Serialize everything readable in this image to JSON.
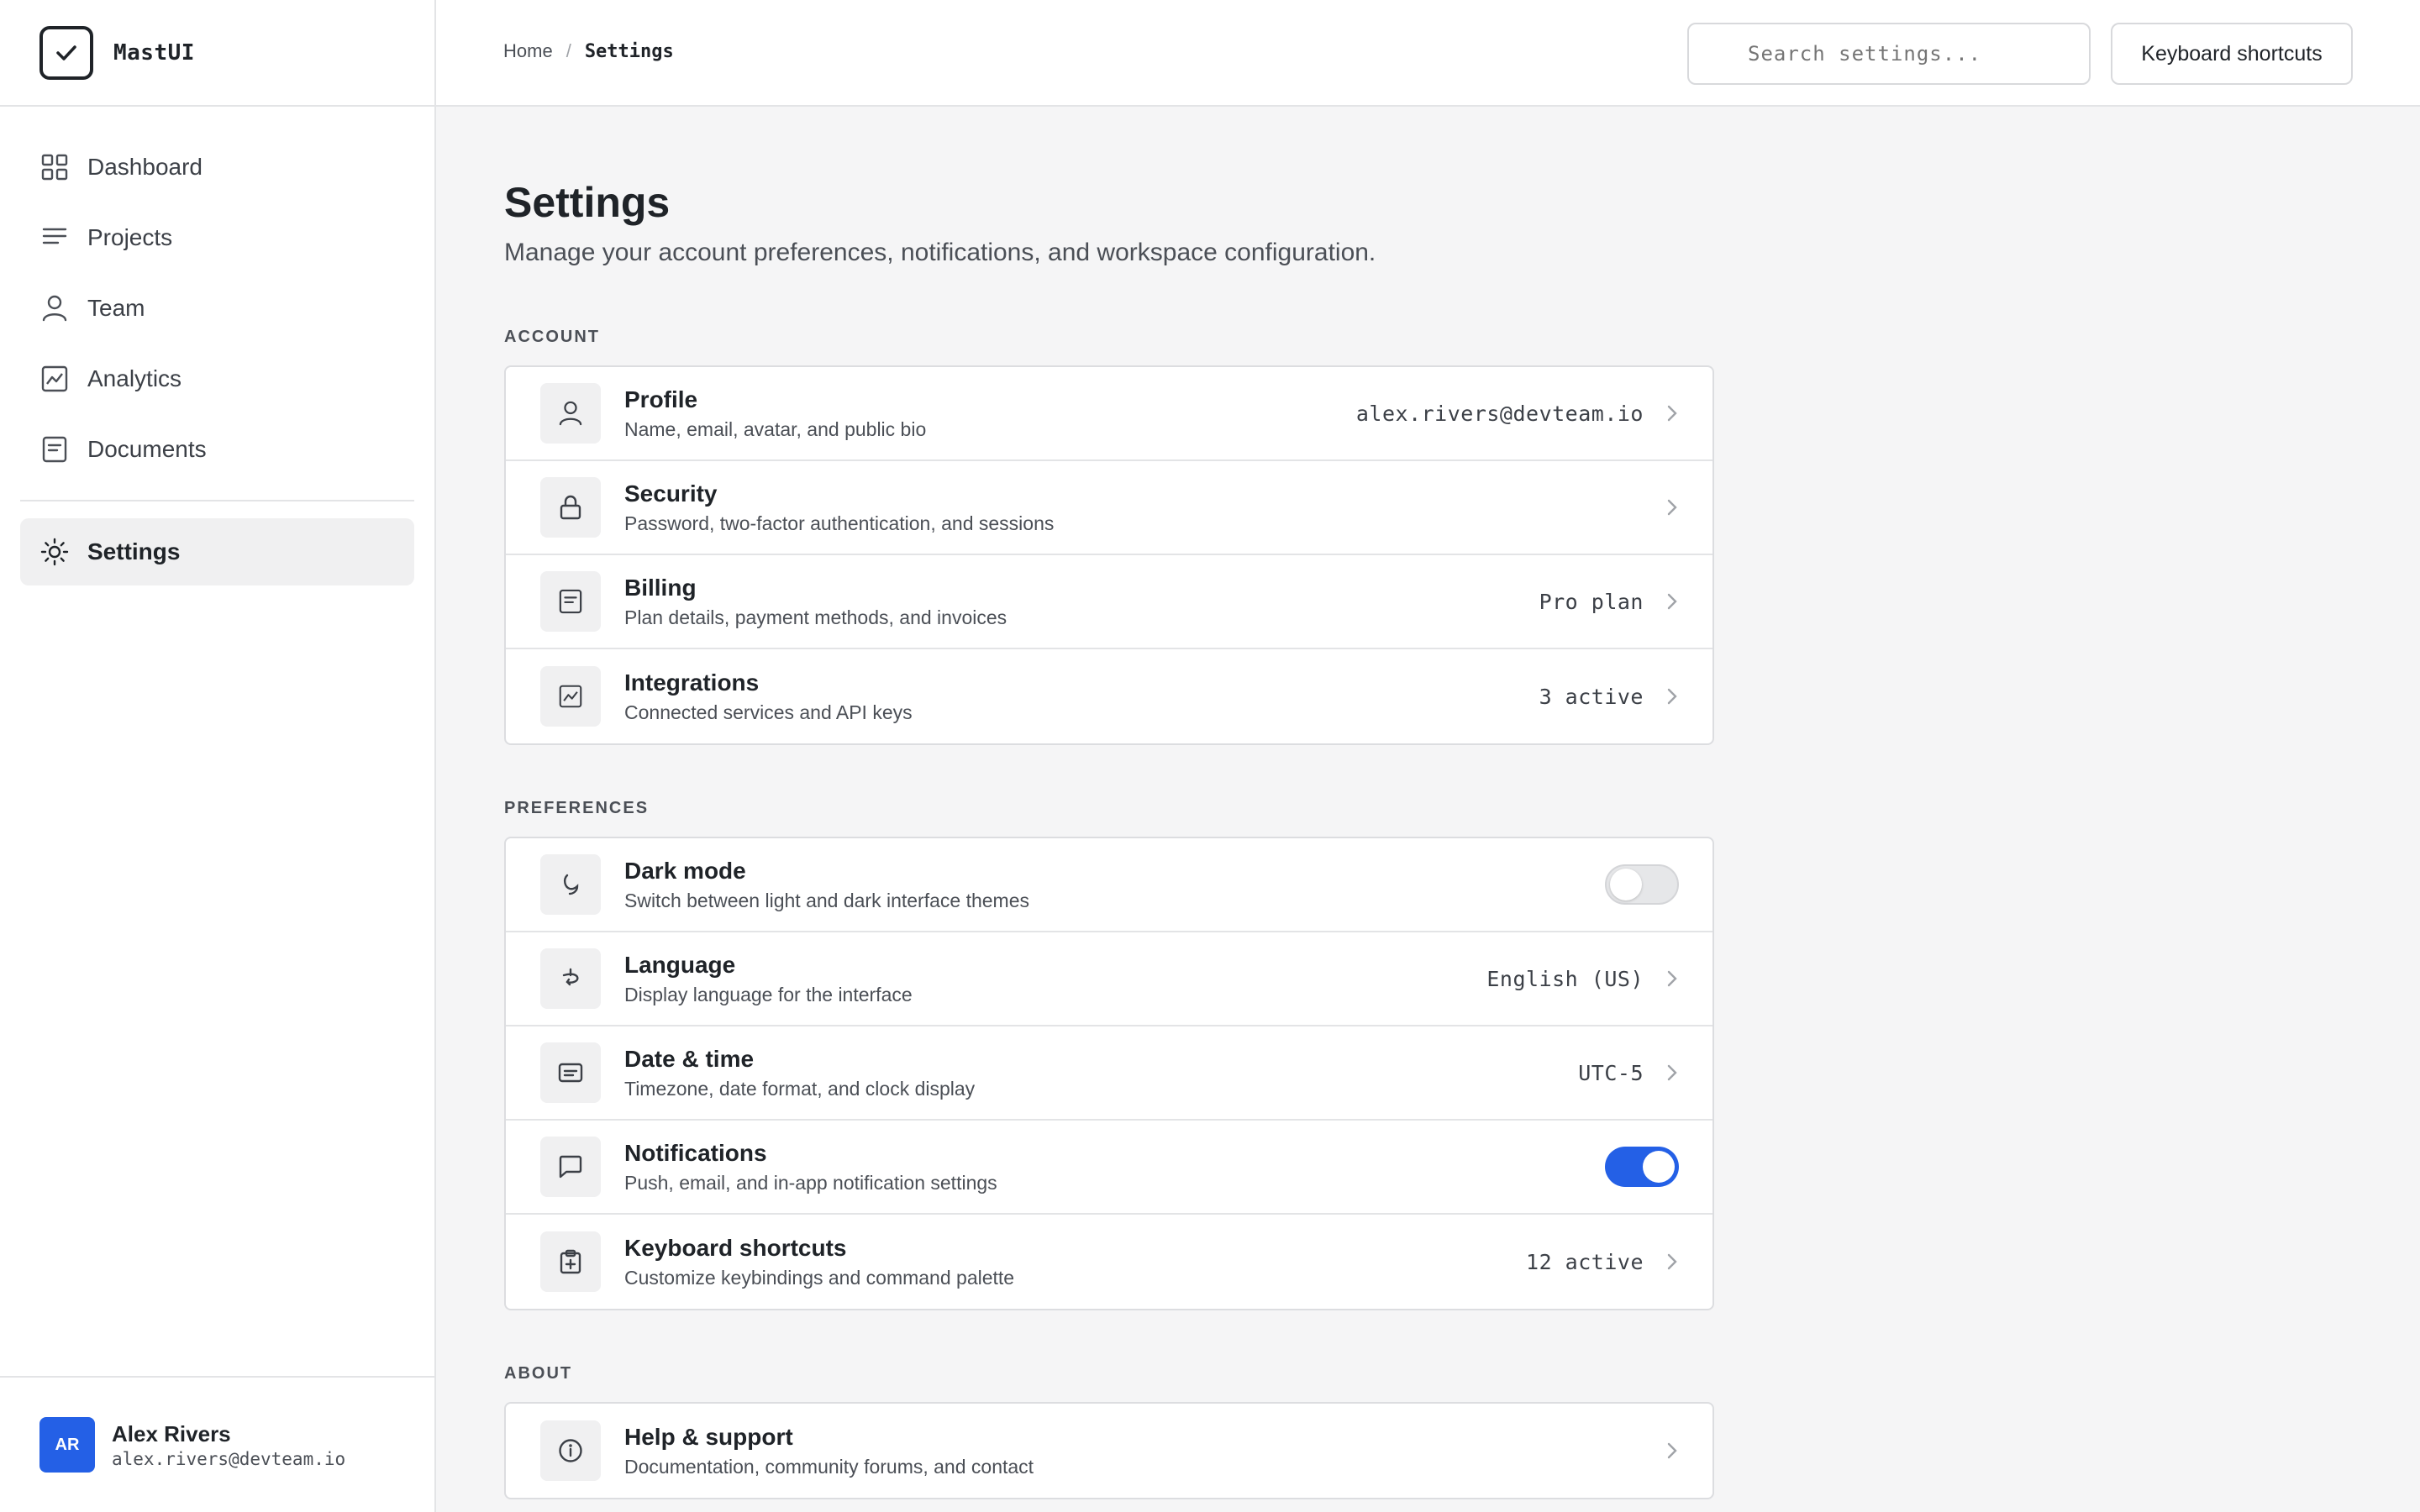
{
  "brand": {
    "name": "MastUI"
  },
  "nav": {
    "items": [
      {
        "label": "Dashboard"
      },
      {
        "label": "Projects"
      },
      {
        "label": "Team"
      },
      {
        "label": "Analytics"
      },
      {
        "label": "Documents"
      }
    ],
    "active": {
      "label": "Settings"
    }
  },
  "user": {
    "initials": "AR",
    "name": "Alex Rivers",
    "email": "alex.rivers@devteam.io"
  },
  "topbar": {
    "breadcrumb": {
      "home": "Home",
      "separator": "/",
      "current": "Settings"
    },
    "search_placeholder": "Search settings...",
    "shortcuts_button": "Keyboard shortcuts"
  },
  "page": {
    "title": "Settings",
    "subtitle": "Manage your account preferences, notifications, and workspace configuration."
  },
  "sections": {
    "account": {
      "label": "Account",
      "rows": [
        {
          "title": "Profile",
          "desc": "Name, email, avatar, and public bio",
          "value": "alex.rivers@devteam.io"
        },
        {
          "title": "Security",
          "desc": "Password, two-factor authentication, and sessions",
          "value": ""
        },
        {
          "title": "Billing",
          "desc": "Plan details, payment methods, and invoices",
          "value": "Pro plan"
        },
        {
          "title": "Integrations",
          "desc": "Connected services and API keys",
          "value": "3 active"
        }
      ]
    },
    "preferences": {
      "label": "Preferences",
      "rows": [
        {
          "title": "Dark mode",
          "desc": "Switch between light and dark interface themes",
          "toggle": false
        },
        {
          "title": "Language",
          "desc": "Display language for the interface",
          "value": "English (US)"
        },
        {
          "title": "Date & time",
          "desc": "Timezone, date format, and clock display",
          "value": "UTC-5"
        },
        {
          "title": "Notifications",
          "desc": "Push, email, and in-app notification settings",
          "toggle": true
        },
        {
          "title": "Keyboard shortcuts",
          "desc": "Customize keybindings and command palette",
          "value": "12 active"
        }
      ]
    },
    "about": {
      "label": "About",
      "rows": [
        {
          "title": "Help & support",
          "desc": "Documentation, community forums, and contact",
          "value": ""
        }
      ]
    }
  },
  "colors": {
    "accent": "#2460e6",
    "background": "#f5f5f6",
    "border": "#dcdde0"
  }
}
